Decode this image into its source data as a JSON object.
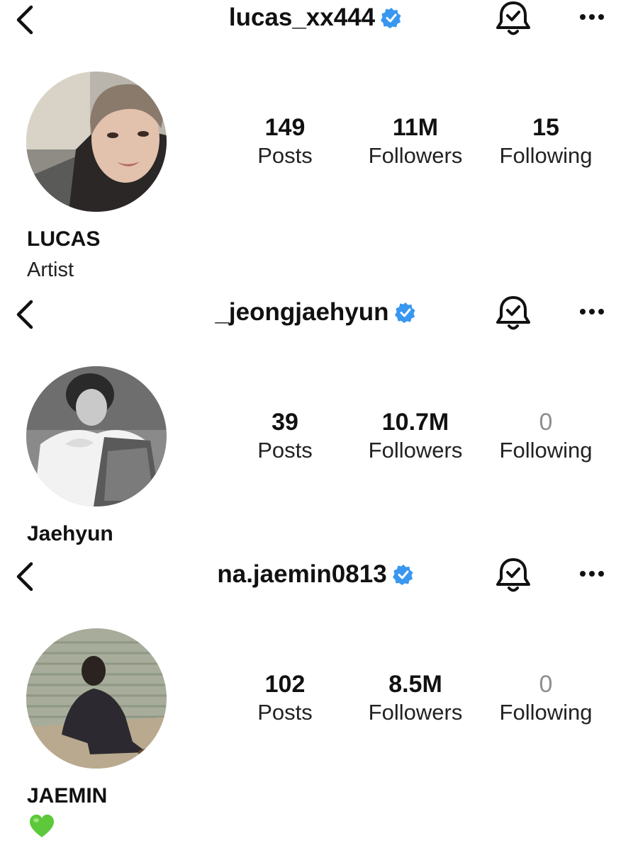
{
  "profiles": [
    {
      "username": "lucas_xx444",
      "verified": true,
      "display_name": "LUCAS",
      "bio": "Artist",
      "stats": {
        "posts": {
          "value": "149",
          "label": "Posts"
        },
        "followers": {
          "value": "11M",
          "label": "Followers"
        },
        "following": {
          "value": "15",
          "label": "Following"
        }
      }
    },
    {
      "username": "_jeongjaehyun",
      "verified": true,
      "display_name": "Jaehyun",
      "stats": {
        "posts": {
          "value": "39",
          "label": "Posts"
        },
        "followers": {
          "value": "10.7M",
          "label": "Followers"
        },
        "following": {
          "value": "0",
          "label": "Following"
        }
      }
    },
    {
      "username": "na.jaemin0813",
      "verified": true,
      "display_name": "JAEMIN",
      "bio_icon": "green-heart-emoji",
      "stats": {
        "posts": {
          "value": "102",
          "label": "Posts"
        },
        "followers": {
          "value": "8.5M",
          "label": "Followers"
        },
        "following": {
          "value": "0",
          "label": "Following"
        }
      }
    }
  ],
  "icons": {
    "back": "chevron-left-icon",
    "verified": "verified-badge-icon",
    "notifications": "bell-check-icon",
    "more": "more-horizontal-icon"
  },
  "colors": {
    "verified_blue": "#3897f0",
    "zero_gray": "#8e8e8e",
    "heart_green": "#5cc83a"
  }
}
